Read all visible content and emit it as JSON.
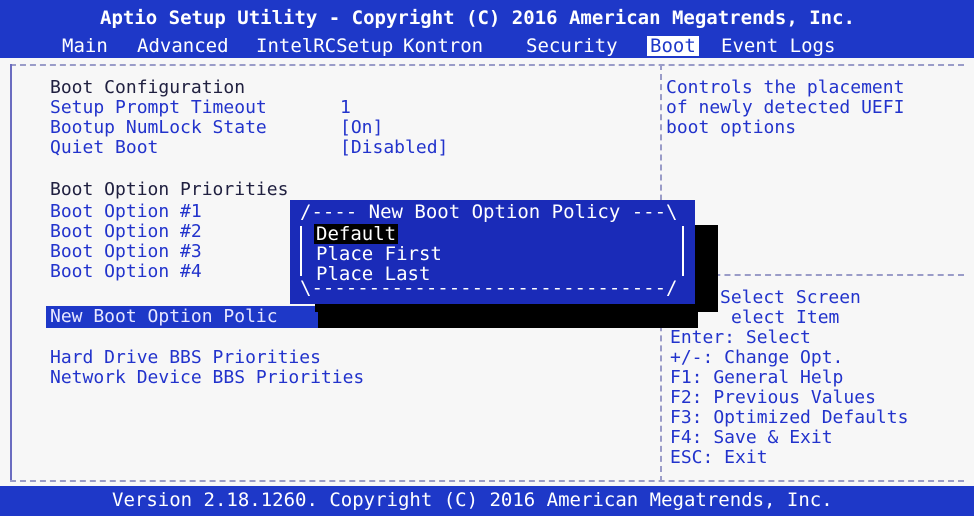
{
  "header": {
    "title": "Aptio Setup Utility - Copyright (C) 2016 American Megatrends, Inc.",
    "tabs": [
      {
        "label": "Main",
        "active": false
      },
      {
        "label": "Advanced",
        "active": false
      },
      {
        "label": "IntelRCSetup",
        "active": false
      },
      {
        "label": "Kontron",
        "active": false
      },
      {
        "label": "Security",
        "active": false
      },
      {
        "label": "Boot",
        "active": true
      },
      {
        "label": "Event Logs",
        "active": false
      }
    ]
  },
  "boot_config": {
    "heading": "Boot Configuration",
    "items": [
      {
        "label": "Setup Prompt Timeout",
        "value": "1"
      },
      {
        "label": "Bootup NumLock State",
        "value": "[On]"
      },
      {
        "label": "Quiet Boot",
        "value": "[Disabled]"
      }
    ]
  },
  "priorities": {
    "heading": "Boot Option Priorities",
    "items": [
      "Boot Option #1",
      "Boot Option #2",
      "Boot Option #3",
      "Boot Option #4"
    ]
  },
  "new_policy_label": "New Boot Option Polic",
  "submenus": [
    "Hard Drive BBS Priorities",
    "Network Device BBS Priorities"
  ],
  "popup": {
    "title": "/---- New Boot Option Policy ---\\",
    "bottom": "\\-------------------------------/",
    "options": [
      {
        "label": "Default",
        "selected": true
      },
      {
        "label": "Place First",
        "selected": false
      },
      {
        "label": "Place Last",
        "selected": false
      }
    ]
  },
  "help": {
    "lines": [
      "Controls the placement",
      "of newly detected UEFI",
      "boot options"
    ]
  },
  "keys": [
    "Select Screen",
    "elect Item",
    "Enter: Select",
    "+/-: Change Opt.",
    "F1: General Help",
    "F2: Previous Values",
    "F3: Optimized Defaults",
    "F4: Save & Exit",
    "ESC: Exit"
  ],
  "footer": "Version 2.18.1260. Copyright (C) 2016 American Megatrends, Inc.",
  "colors": {
    "bios_blue": "#1e38c8",
    "text_blue": "#2233cc",
    "background": "#f7f7f7"
  }
}
